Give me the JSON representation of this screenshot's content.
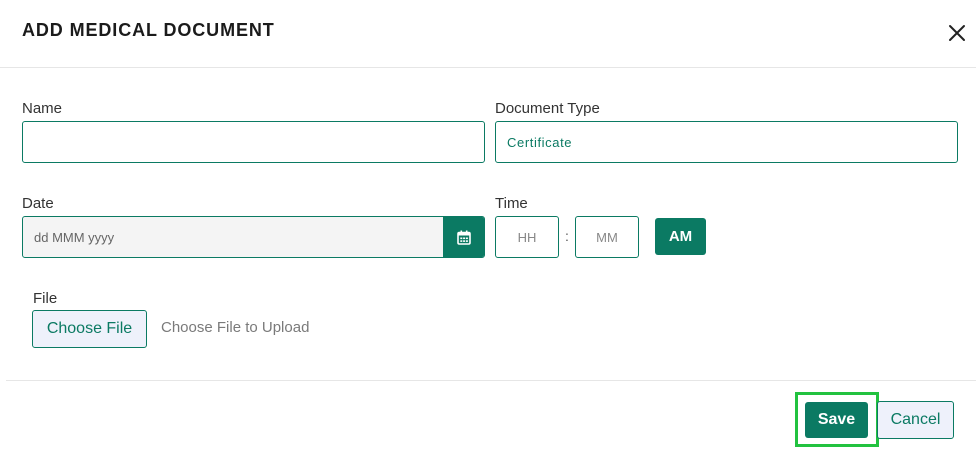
{
  "dialog": {
    "title": "ADD MEDICAL DOCUMENT",
    "close_icon": "close-icon"
  },
  "form": {
    "name": {
      "label": "Name",
      "value": ""
    },
    "document_type": {
      "label": "Document Type",
      "value": "Certificate"
    },
    "date": {
      "label": "Date",
      "placeholder": "dd MMM yyyy",
      "icon": "calendar-icon"
    },
    "time": {
      "label": "Time",
      "hours_placeholder": "HH",
      "separator": ":",
      "minutes_placeholder": "MM",
      "period": "AM"
    },
    "file": {
      "label": "File",
      "button_label": "Choose File",
      "hint": "Choose File to Upload"
    }
  },
  "footer": {
    "save_label": "Save",
    "cancel_label": "Cancel"
  },
  "colors": {
    "accent": "#0b7a63",
    "highlight": "#22c23f",
    "button_light_bg": "#eef1fb"
  }
}
